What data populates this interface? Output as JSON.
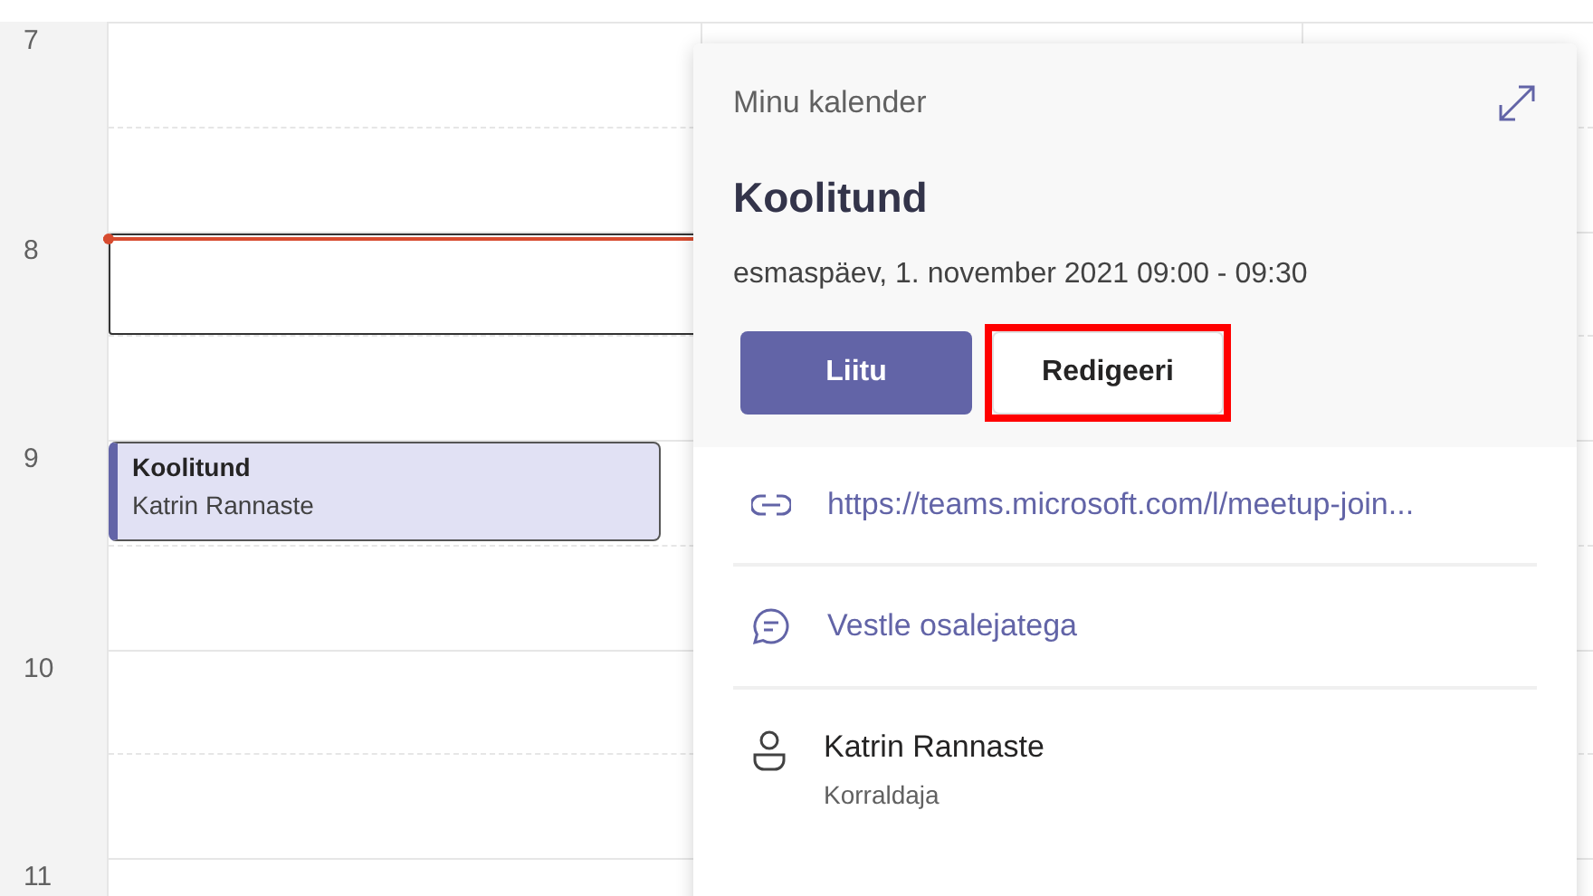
{
  "hours": [
    {
      "label": "7",
      "selected": false,
      "current_time": false
    },
    {
      "label": "8",
      "selected": true,
      "current_time": true
    },
    {
      "label": "9",
      "selected": false,
      "current_time": false,
      "event": {
        "title": "Koolitund",
        "organizer": "Katrin Rannaste"
      }
    },
    {
      "label": "10",
      "selected": false,
      "current_time": false
    },
    {
      "label": "11",
      "selected": false,
      "current_time": false
    }
  ],
  "popup": {
    "calendar": "Minu kalender",
    "title": "Koolitund",
    "datetime": "esmaspäev, 1. november 2021 09:00 - 09:30",
    "buttons": [
      {
        "label": "Liitu",
        "kind": "primary",
        "highlighted": false
      },
      {
        "label": "Redigeeri",
        "kind": "secondary",
        "highlighted": true
      }
    ],
    "details": [
      {
        "kind": "link",
        "text": "https://teams.microsoft.com/l/meetup-join..."
      },
      {
        "kind": "chat",
        "text": "Vestle osalejatega"
      },
      {
        "kind": "person",
        "text": "Katrin Rannaste",
        "role": "Korraldaja"
      }
    ]
  }
}
